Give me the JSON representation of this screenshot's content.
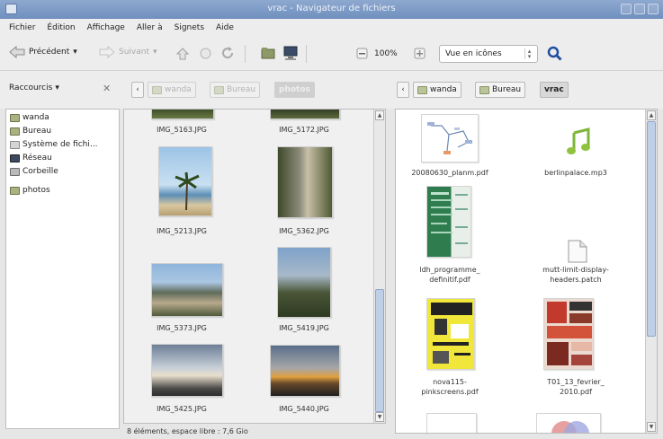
{
  "window": {
    "title": "vrac - Navigateur de fichiers"
  },
  "menu": [
    "Fichier",
    "Édition",
    "Affichage",
    "Aller à",
    "Signets",
    "Aide"
  ],
  "toolbar": {
    "back": "Précédent",
    "forward": "Suivant",
    "zoom": "100%",
    "view_mode": "Vue en icônes"
  },
  "sidebar": {
    "selector": "Raccourcis",
    "items": [
      "wanda",
      "Bureau",
      "Système de fichi...",
      "Réseau",
      "Corbeille",
      "photos"
    ]
  },
  "left_pane": {
    "path": [
      "wanda",
      "Bureau",
      "photos"
    ],
    "files": [
      "IMG_5163.JPG",
      "IMG_5172.JPG",
      "IMG_5213.JPG",
      "IMG_5362.JPG",
      "IMG_5373.JPG",
      "IMG_5419.JPG",
      "IMG_5425.JPG",
      "IMG_5440.JPG"
    ],
    "status": "8 éléments, espace libre : 7,6 Gio"
  },
  "right_pane": {
    "path": [
      "wanda",
      "Bureau",
      "vrac"
    ],
    "files": [
      [
        "20080630_planm.pdf"
      ],
      [
        "berlinpalace.mp3"
      ],
      [
        "ldh_programme_",
        "definitif.pdf"
      ],
      [
        "mutt-limit-display-",
        "headers.patch"
      ],
      [
        "nova115-",
        "pinkscreens.pdf"
      ],
      [
        "T01_13_fevrier_",
        "2010.pdf"
      ]
    ]
  }
}
